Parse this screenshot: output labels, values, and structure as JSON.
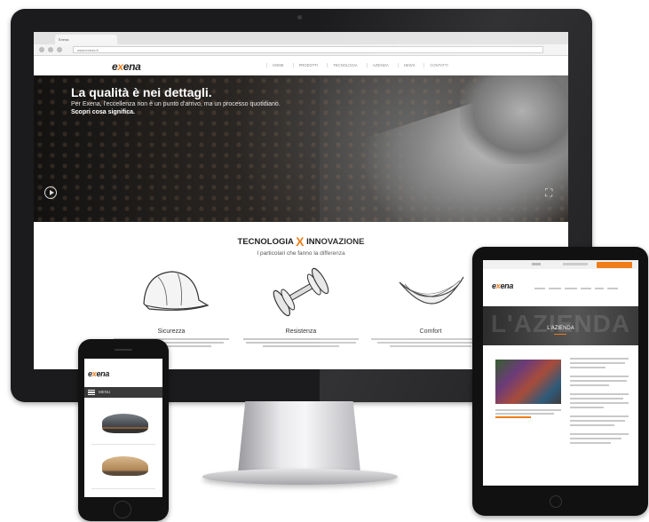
{
  "desktop": {
    "browser": {
      "tab_title": "Exena",
      "url": "www.exena.it"
    },
    "brand": {
      "logo_prefix": "e",
      "logo_x": "x",
      "logo_suffix": "ena"
    },
    "nav": [
      {
        "label": "HOME"
      },
      {
        "label": "PRODOTTI"
      },
      {
        "label": "TECNOLOGIA"
      },
      {
        "label": "AZIENDA"
      },
      {
        "label": "NEWS"
      },
      {
        "label": "CONTATTI"
      }
    ],
    "hero": {
      "title": "La qualità è nei dettagli.",
      "subtitle": "Per Exena, l'eccellenza non è un punto d'arrivo, ma un processo quotidiano.",
      "cta": "Scopri cosa significa."
    },
    "features": {
      "title_left": "TECNOLOGIA",
      "title_x": "X",
      "title_right": "INNOVAZIONE",
      "subtitle": "I particolari che fanno la differenza",
      "items": [
        {
          "label": "Sicurezza",
          "icon": "helmet-icon"
        },
        {
          "label": "Resistenza",
          "icon": "dumbbell-icon"
        },
        {
          "label": "Comfort",
          "icon": "comfort-icon"
        }
      ]
    }
  },
  "phone": {
    "brand": {
      "logo_prefix": "e",
      "logo_x": "x",
      "logo_suffix": "ena"
    },
    "menu_label": "MENU"
  },
  "tablet": {
    "brand": {
      "logo_prefix": "e",
      "logo_x": "x",
      "logo_suffix": "ena"
    },
    "banner_bg_text": "L'AZIENDA",
    "banner_title": "L'AZIENDA"
  },
  "colors": {
    "accent": "#ef7d1a",
    "bezel": "#1b1b1d",
    "hero_dark": "#1e1b19"
  }
}
